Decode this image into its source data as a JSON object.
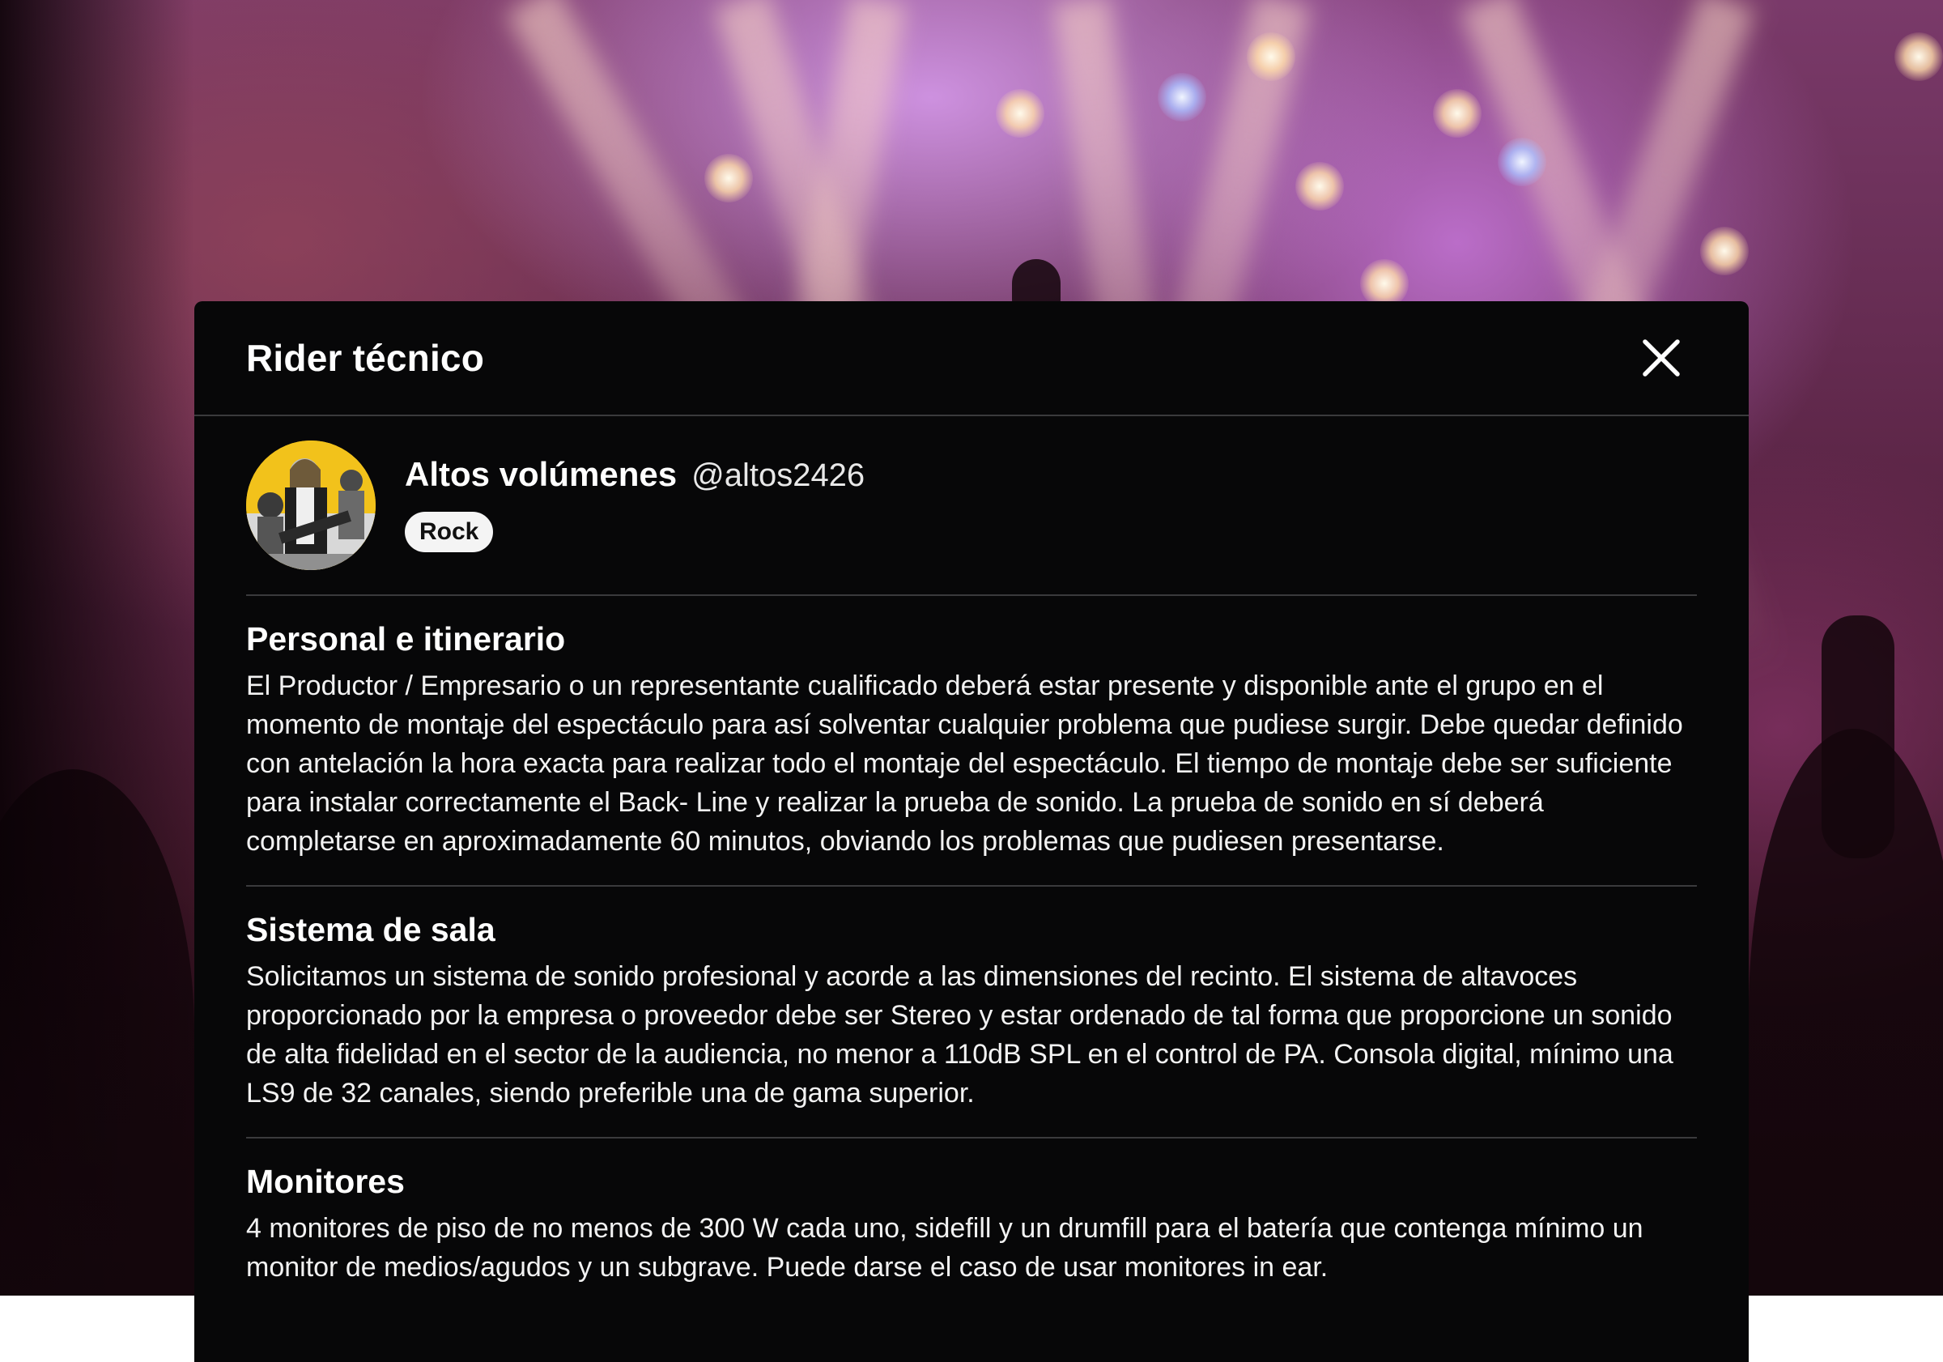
{
  "modal": {
    "title": "Rider técnico",
    "close_icon": "close-icon"
  },
  "profile": {
    "name": "Altos volúmenes",
    "handle": "@altos2426",
    "genre": "Rock",
    "avatar_icon": "band-avatar"
  },
  "sections": [
    {
      "title": "Personal e itinerario",
      "text": "El Productor / Empresario o un representante cualificado deberá estar presente y disponible ante el grupo en el momento de montaje del espectáculo para así solventar cualquier problema que pudiese surgir. Debe quedar definido con antelación la hora exacta para realizar todo el montaje del espectáculo. El tiempo de montaje debe ser suficiente para instalar correctamente el Back- Line y realizar la prueba de sonido. La prueba de sonido en sí deberá completarse en aproximadamente 60 minutos, obviando los problemas que pudiesen presentarse."
    },
    {
      "title": "Sistema de sala",
      "text": "Solicitamos un sistema de sonido profesional y acorde a las dimensiones del recinto. El sistema de altavoces proporcionado por la empresa o proveedor debe ser Stereo y estar ordenado de tal forma que proporcione un sonido de alta fidelidad en el sector de la audiencia, no menor a 110dB SPL en el control de PA. Consola digital, mínimo una LS9 de 32 canales, siendo preferible una de gama superior."
    },
    {
      "title": "Monitores",
      "text": "4 monitores de piso de no menos de 300 W cada uno, sidefill y un drumfill para el batería que contenga mínimo un monitor de medios/agudos y un subgrave. Puede darse el caso de usar monitores in ear."
    }
  ],
  "colors": {
    "modal_bg": "#070708",
    "divider": "#3a3a3c",
    "badge_bg": "#f4f4f4",
    "avatar_bg": "#f2c21b"
  }
}
